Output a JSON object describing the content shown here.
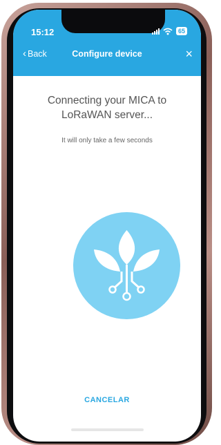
{
  "status_bar": {
    "time": "15:12",
    "battery": "65"
  },
  "nav": {
    "back_label": "Back",
    "title": "Configure device",
    "close_symbol": "×"
  },
  "main": {
    "heading": "Connecting your MICA to LoRaWAN server...",
    "subtext": "It will only take a few seconds",
    "logo_icon": "plant-circuit-icon"
  },
  "actions": {
    "cancel_label": "CANCELAR"
  },
  "colors": {
    "primary": "#29a7e1",
    "logo_bg": "#7fd2f3",
    "text": "#555555"
  }
}
